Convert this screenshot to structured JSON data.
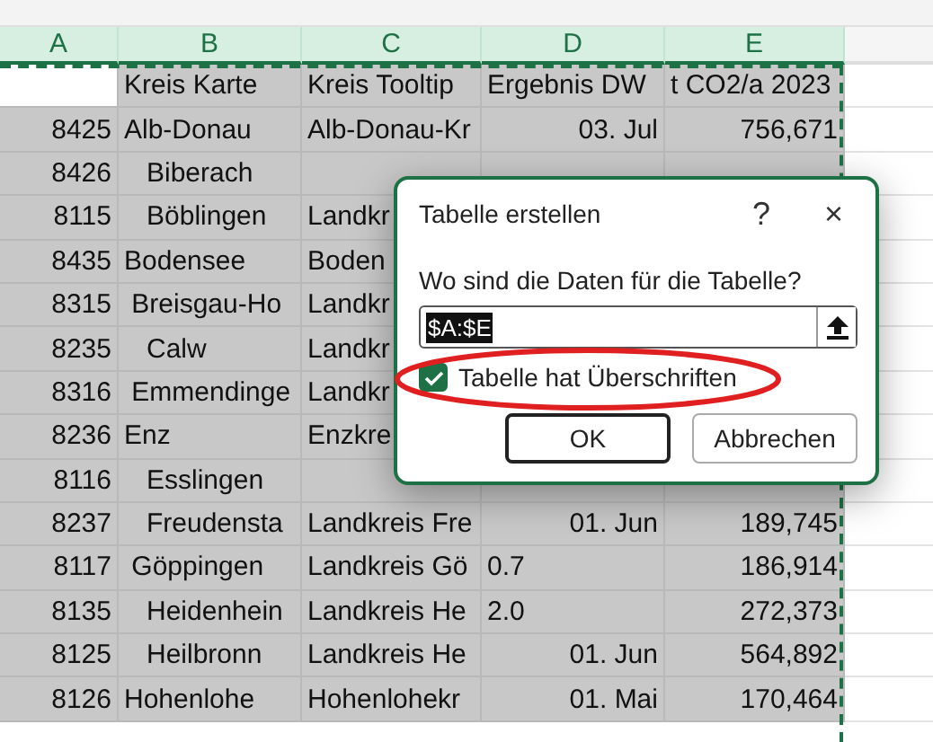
{
  "columns": [
    {
      "label": "A",
      "selected": true
    },
    {
      "label": "B",
      "selected": true
    },
    {
      "label": "C",
      "selected": true
    },
    {
      "label": "D",
      "selected": true
    },
    {
      "label": "E",
      "selected": true
    }
  ],
  "rows": [
    {
      "kind": "header",
      "b": "Kreis Karte",
      "c": "Kreis Tooltip",
      "d": "Ergebnis DW",
      "e": "t CO2/a 2023"
    },
    {
      "kind": "data",
      "a": "8425",
      "b": "Alb-Donau",
      "c": "Alb-Donau-Kr",
      "d": "03. Jul",
      "e": "756,671",
      "d_left": false
    },
    {
      "kind": "data",
      "a": "8426",
      "b": "   Biberach"
    },
    {
      "kind": "data",
      "a": "8115",
      "b": "   Böblingen",
      "c": "Landkr"
    },
    {
      "kind": "data",
      "a": "8435",
      "b": "Bodensee",
      "c": "Boden"
    },
    {
      "kind": "data",
      "a": "8315",
      "b": " Breisgau-Ho",
      "c": "Landkr"
    },
    {
      "kind": "data",
      "a": "8235",
      "b": "   Calw",
      "c": "Landkr"
    },
    {
      "kind": "data",
      "a": "8316",
      "b": " Emmendinge",
      "c": "Landkr"
    },
    {
      "kind": "data",
      "a": "8236",
      "b": "Enz",
      "c": "Enzkre"
    },
    {
      "kind": "data",
      "a": "8116",
      "b": "   Esslingen"
    },
    {
      "kind": "data",
      "a": "8237",
      "b": "   Freudensta",
      "c": "Landkreis Fre",
      "d": "01. Jun",
      "e": "189,745",
      "d_left": false
    },
    {
      "kind": "data",
      "a": "8117",
      "b": " Göppingen",
      "c": "Landkreis Gö",
      "d": "0.7",
      "e": "186,914",
      "d_left": true
    },
    {
      "kind": "data",
      "a": "8135",
      "b": "   Heidenhein",
      "c": "Landkreis He",
      "d": "2.0",
      "e": "272,373",
      "d_left": true
    },
    {
      "kind": "data",
      "a": "8125",
      "b": "   Heilbronn",
      "c": "Landkreis He",
      "d": "01. Jun",
      "e": "564,892",
      "d_left": false
    },
    {
      "kind": "data",
      "a": "8126",
      "b": "Hohenlohe",
      "c": "Hohenlohekr",
      "d": "01. Mai",
      "e": "170,464",
      "d_left": false
    }
  ],
  "dialog": {
    "title": "Tabelle erstellen",
    "help": "?",
    "close": "×",
    "prompt": "Wo sind die Daten für die Tabelle?",
    "range_value": "$A:$E",
    "has_headers": {
      "label": "Tabelle hat Überschriften",
      "checked": true,
      "highlighted": true
    },
    "buttons": [
      {
        "label": "OK",
        "default": true
      },
      {
        "label": "Abbrechen",
        "default": false
      }
    ]
  }
}
